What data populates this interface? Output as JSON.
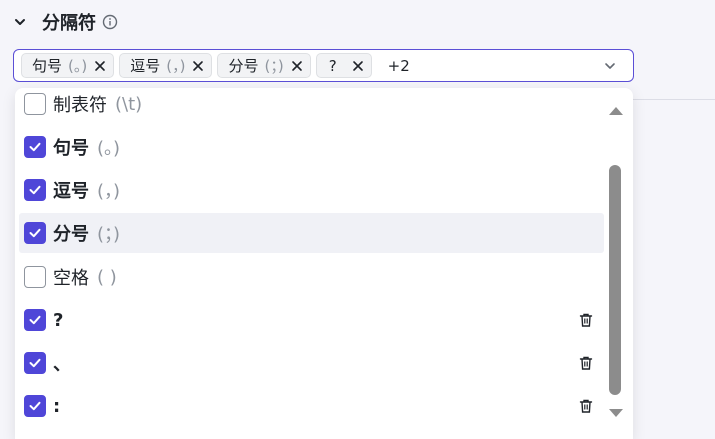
{
  "section": {
    "title": "分隔符",
    "collapse_icon": "chevron-down-icon",
    "info_icon": "info-icon"
  },
  "select": {
    "tags": [
      {
        "label": "句号",
        "hint": "(。)"
      },
      {
        "label": "逗号",
        "hint": "(，)"
      },
      {
        "label": "分号",
        "hint": "(；)"
      },
      {
        "label": "?",
        "hint": ""
      }
    ],
    "more": "+2",
    "border_color": "#5b4fd6"
  },
  "dropdown": {
    "options": [
      {
        "label": "制表符",
        "hint": "(\\t)",
        "checked": false,
        "deletable": false
      },
      {
        "label": "句号",
        "hint": "(。)",
        "checked": true,
        "deletable": false
      },
      {
        "label": "逗号",
        "hint": "(，)",
        "checked": true,
        "deletable": false
      },
      {
        "label": "分号",
        "hint": "(；)",
        "checked": true,
        "deletable": false,
        "hovered": true
      },
      {
        "label": "空格",
        "hint": "( )",
        "checked": false,
        "deletable": false
      },
      {
        "label": "?",
        "hint": "",
        "checked": true,
        "deletable": true
      },
      {
        "label": "、",
        "hint": "",
        "checked": true,
        "deletable": true
      },
      {
        "label": ":",
        "hint": "",
        "checked": true,
        "deletable": true
      }
    ],
    "check_color": "#4f46d8"
  }
}
